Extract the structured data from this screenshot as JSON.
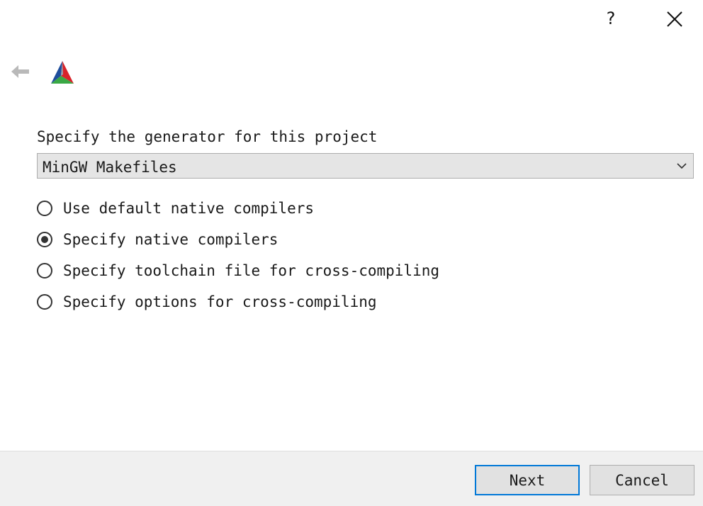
{
  "titlebar": {
    "help_label": "?",
    "icons": {
      "close": "close-icon",
      "back": "back-arrow-icon",
      "logo": "cmake-logo-icon"
    }
  },
  "page": {
    "prompt": "Specify the generator for this project",
    "generator": {
      "selected": "MinGW Makefiles",
      "arrow_icon": "chevron-down-icon"
    },
    "options": [
      {
        "label": "Use default native compilers",
        "checked": false
      },
      {
        "label": "Specify native compilers",
        "checked": true
      },
      {
        "label": "Specify toolchain file for cross-compiling",
        "checked": false
      },
      {
        "label": "Specify options for cross-compiling",
        "checked": false
      }
    ]
  },
  "footer": {
    "next_label": "Next",
    "cancel_label": "Cancel"
  },
  "colors": {
    "accent": "#0078d7",
    "footer_bg": "#f0f0f0",
    "combo_bg": "#e5e5e5",
    "logo_blue": "#1f4e9c",
    "logo_red": "#d8232a",
    "logo_green": "#3aa845"
  }
}
